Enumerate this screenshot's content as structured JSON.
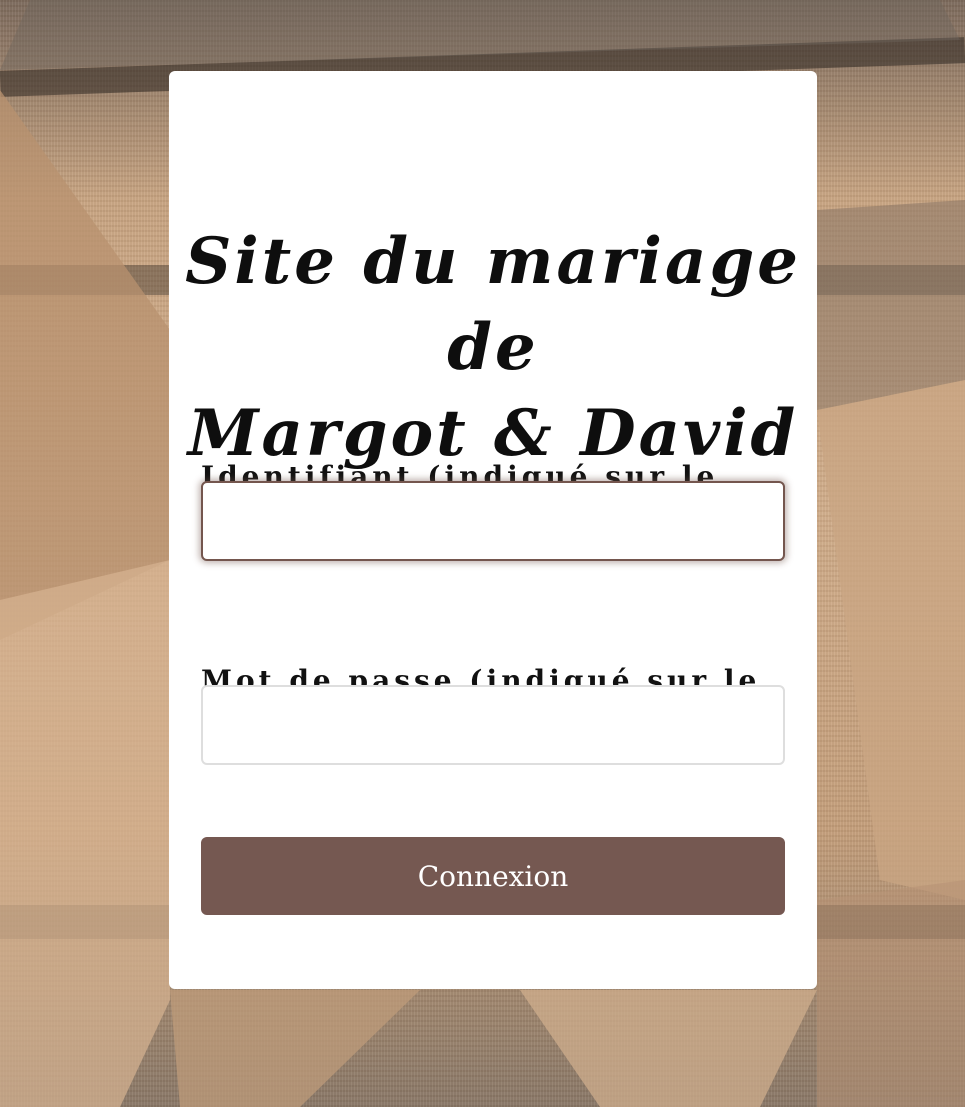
{
  "login": {
    "title_line1": "Site du mariage de",
    "title_line2": "Margot & David",
    "identifier_label": "Identifiant (indiqué sur le faire-part) :",
    "identifier_value": "",
    "password_label": "Mot de passe (indiqué sur le faire-part) :",
    "password_value": "",
    "submit_label": "Connexion"
  },
  "colors": {
    "accent": "#755851",
    "card_background": "#ffffff",
    "text": "#0e0e0e"
  }
}
